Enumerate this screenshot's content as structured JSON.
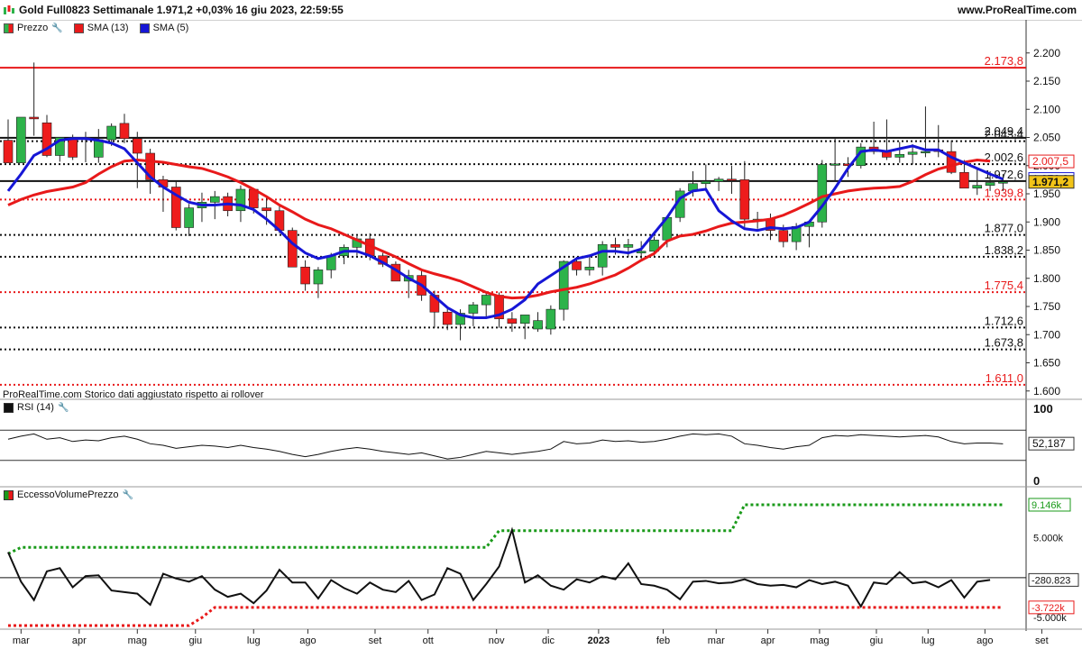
{
  "header": {
    "title": "Gold Full0823 Settimanale 1.971,2 +0,03% 16 giu 2023, 22:59:55",
    "site": "www.ProRealTime.com"
  },
  "legend": {
    "price_label": "Prezzo",
    "sma13_label": "SMA (13)",
    "sma5_label": "SMA (5)"
  },
  "history_note": "ProRealTime.com Storico dati aggiustato rispetto ai rollover",
  "rsi_panel": {
    "label": "RSI (14)",
    "top_tick": "100",
    "bottom_tick": "0",
    "current_value": "52,187"
  },
  "excess_panel": {
    "label": "EccessoVolumePrezzo",
    "top_value": "9.146k",
    "current_value": "-280.823",
    "bottom_value": "-3.722k",
    "tick_5000": "5.000k",
    "tick_0": "0",
    "tick_m5000": "-5.000k"
  },
  "colors": {
    "up": "#2db34a",
    "down": "#ee1c1c",
    "sma13": "#e8191a",
    "sma5": "#1616d6",
    "level_red": "#e8191a",
    "level_black": "#111111",
    "last_price_bg": "#f2c417",
    "accent_green": "#1a9a1a"
  },
  "chart_data": {
    "type": "candlestick",
    "ylim": [
      1590,
      2230
    ],
    "y_ticks": [
      "2.200",
      "2.150",
      "2.100",
      "2.050",
      "2.000",
      "1.950",
      "1.900",
      "1.850",
      "1.800",
      "1.750",
      "1.700",
      "1.650",
      "1.600"
    ],
    "y_tick_values": [
      2200,
      2150,
      2100,
      2050,
      2000,
      1950,
      1900,
      1850,
      1800,
      1750,
      1700,
      1650,
      1600
    ],
    "x_ticks": [
      {
        "label": "mar",
        "week": 1
      },
      {
        "label": "apr",
        "week": 5.5
      },
      {
        "label": "mag",
        "week": 10
      },
      {
        "label": "giu",
        "week": 14.5
      },
      {
        "label": "lug",
        "week": 19
      },
      {
        "label": "ago",
        "week": 23.2
      },
      {
        "label": "set",
        "week": 28.4
      },
      {
        "label": "ott",
        "week": 32.5
      },
      {
        "label": "nov",
        "week": 37.8
      },
      {
        "label": "dic",
        "week": 41.8
      },
      {
        "label": "2023",
        "week": 45.7
      },
      {
        "label": "feb",
        "week": 50.7
      },
      {
        "label": "mar",
        "week": 54.8
      },
      {
        "label": "apr",
        "week": 58.8
      },
      {
        "label": "mag",
        "week": 62.8
      },
      {
        "label": "giu",
        "week": 67.2
      },
      {
        "label": "lug",
        "week": 71.2
      },
      {
        "label": "ago",
        "week": 75.6
      },
      {
        "label": "set",
        "week": 80.0
      }
    ],
    "horizontal_levels": [
      {
        "value": 2173.8,
        "label": "2.173,8",
        "color": "red",
        "style": "solid"
      },
      {
        "value": 2049.4,
        "label": "2.049,4",
        "color": "black",
        "style": "solid"
      },
      {
        "value": 2043.4,
        "label": "2.043,4",
        "color": "black",
        "style": "dotted"
      },
      {
        "value": 2002.6,
        "label": "2.002,6",
        "color": "black",
        "style": "dotted"
      },
      {
        "value": 1972.6,
        "label": "1.972,6",
        "color": "black",
        "style": "solid"
      },
      {
        "value": 1939.8,
        "label": "1.939,8",
        "color": "red",
        "style": "dotted"
      },
      {
        "value": 1877.0,
        "label": "1.877,0",
        "color": "black",
        "style": "dotted"
      },
      {
        "value": 1838.2,
        "label": "1.838,2",
        "color": "black",
        "style": "dotted"
      },
      {
        "value": 1775.4,
        "label": "1.775,4",
        "color": "red",
        "style": "dotted"
      },
      {
        "value": 1712.6,
        "label": "1.712,6",
        "color": "black",
        "style": "dotted"
      },
      {
        "value": 1673.8,
        "label": "1.673,8",
        "color": "black",
        "style": "dotted"
      },
      {
        "value": 1611.0,
        "label": "1.611,0",
        "color": "red",
        "style": "dotted"
      }
    ],
    "last_price": {
      "value": 1971.2,
      "label": "1.971,2"
    },
    "sma13_last": {
      "value": 2007.5,
      "label": "2.007,5"
    },
    "sma5_last": {
      "value": 1976.3,
      "label": "1.976,3"
    },
    "candles": [
      [
        2045,
        2082,
        2008,
        2005
      ],
      [
        2005,
        2070,
        2010,
        2086
      ],
      [
        2086,
        2183,
        2053,
        2083
      ],
      [
        2076,
        2090,
        2015,
        2018
      ],
      [
        2018,
        2040,
        2007,
        2050
      ],
      [
        2048,
        2055,
        2010,
        2015
      ],
      [
        2050,
        2060,
        2006,
        2048
      ],
      [
        2015,
        2065,
        2005,
        2046
      ],
      [
        2046,
        2075,
        2035,
        2070
      ],
      [
        2075,
        2092,
        2040,
        2048
      ],
      [
        2048,
        2060,
        1960,
        2022
      ],
      [
        2022,
        2030,
        1950,
        1975
      ],
      [
        1975,
        1982,
        1918,
        1962
      ],
      [
        1962,
        1972,
        1885,
        1890
      ],
      [
        1890,
        1932,
        1875,
        1925
      ],
      [
        1925,
        1952,
        1900,
        1935
      ],
      [
        1935,
        1955,
        1905,
        1945
      ],
      [
        1945,
        1952,
        1910,
        1920
      ],
      [
        1920,
        1965,
        1900,
        1958
      ],
      [
        1958,
        1960,
        1915,
        1925
      ],
      [
        1925,
        1945,
        1895,
        1920
      ],
      [
        1920,
        1928,
        1880,
        1885
      ],
      [
        1885,
        1890,
        1825,
        1820
      ],
      [
        1820,
        1832,
        1778,
        1790
      ],
      [
        1790,
        1820,
        1765,
        1815
      ],
      [
        1815,
        1845,
        1800,
        1840
      ],
      [
        1840,
        1860,
        1825,
        1855
      ],
      [
        1855,
        1875,
        1840,
        1870
      ],
      [
        1870,
        1880,
        1832,
        1840
      ],
      [
        1840,
        1845,
        1820,
        1825
      ],
      [
        1825,
        1830,
        1800,
        1795
      ],
      [
        1795,
        1815,
        1765,
        1805
      ],
      [
        1805,
        1815,
        1760,
        1770
      ],
      [
        1770,
        1778,
        1712,
        1740
      ],
      [
        1740,
        1750,
        1708,
        1718
      ],
      [
        1718,
        1745,
        1690,
        1738
      ],
      [
        1738,
        1758,
        1715,
        1753
      ],
      [
        1753,
        1775,
        1728,
        1770
      ],
      [
        1770,
        1775,
        1712,
        1728
      ],
      [
        1728,
        1740,
        1705,
        1720
      ],
      [
        1720,
        1730,
        1692,
        1735
      ],
      [
        1710,
        1740,
        1705,
        1725
      ],
      [
        1710,
        1752,
        1700,
        1745
      ],
      [
        1745,
        1832,
        1725,
        1830
      ],
      [
        1830,
        1838,
        1805,
        1815
      ],
      [
        1815,
        1840,
        1805,
        1820
      ],
      [
        1820,
        1866,
        1805,
        1860
      ],
      [
        1860,
        1872,
        1842,
        1855
      ],
      [
        1855,
        1870,
        1838,
        1860
      ],
      [
        1845,
        1866,
        1832,
        1848
      ],
      [
        1848,
        1874,
        1840,
        1868
      ],
      [
        1868,
        1908,
        1855,
        1908
      ],
      [
        1908,
        1960,
        1900,
        1955
      ],
      [
        1955,
        1990,
        1945,
        1968
      ],
      [
        1968,
        2002,
        1958,
        1972
      ],
      [
        1972,
        1980,
        1955,
        1976
      ],
      [
        1976,
        2000,
        1950,
        1975
      ],
      [
        1975,
        2008,
        1890,
        1905
      ],
      [
        1905,
        1918,
        1888,
        1905
      ],
      [
        1905,
        1915,
        1868,
        1885
      ],
      [
        1885,
        1895,
        1855,
        1865
      ],
      [
        1865,
        1898,
        1850,
        1892
      ],
      [
        1892,
        1900,
        1855,
        1900
      ],
      [
        1900,
        2010,
        1890,
        2002
      ],
      [
        2002,
        2048,
        1972,
        2003
      ],
      [
        2003,
        2015,
        1980,
        2000
      ],
      [
        2000,
        2040,
        1995,
        2033
      ],
      [
        2033,
        2078,
        2020,
        2025
      ],
      [
        2025,
        2082,
        2010,
        2015
      ],
      [
        2015,
        2042,
        2005,
        2020
      ],
      [
        2020,
        2038,
        2002,
        2024
      ],
      [
        2024,
        2105,
        2015,
        2025
      ],
      [
        2028,
        2072,
        2015,
        2025
      ],
      [
        2025,
        2045,
        1985,
        1988
      ],
      [
        1988,
        2010,
        1962,
        1960
      ],
      [
        1960,
        1996,
        1948,
        1965
      ],
      [
        1965,
        1990,
        1955,
        1970
      ],
      [
        1970,
        1985,
        1955,
        1971.2
      ]
    ],
    "sma13": [
      1930,
      1940,
      1948,
      1954,
      1958,
      1962,
      1970,
      1985,
      1998,
      2008,
      2010,
      2008,
      2006,
      2002,
      1998,
      1995,
      1988,
      1980,
      1970,
      1958,
      1945,
      1930,
      1918,
      1905,
      1895,
      1888,
      1878,
      1868,
      1858,
      1848,
      1838,
      1826,
      1815,
      1808,
      1802,
      1795,
      1785,
      1775,
      1768,
      1765,
      1766,
      1770,
      1776,
      1780,
      1784,
      1790,
      1798,
      1806,
      1818,
      1832,
      1844,
      1866,
      1875,
      1878,
      1884,
      1892,
      1898,
      1900,
      1902,
      1905,
      1912,
      1922,
      1933,
      1945,
      1950,
      1955,
      1958,
      1960,
      1961,
      1963,
      1972,
      1984,
      1994,
      2000,
      2006,
      2010,
      2008
    ],
    "sma5": [
      1955,
      1985,
      2018,
      2030,
      2045,
      2048,
      2048,
      2045,
      2040,
      2030,
      2005,
      1980,
      1962,
      1948,
      1935,
      1930,
      1930,
      1932,
      1930,
      1922,
      1905,
      1885,
      1862,
      1845,
      1835,
      1840,
      1848,
      1848,
      1840,
      1828,
      1815,
      1800,
      1788,
      1768,
      1748,
      1735,
      1730,
      1730,
      1735,
      1745,
      1762,
      1790,
      1805,
      1820,
      1835,
      1840,
      1848,
      1848,
      1845,
      1852,
      1880,
      1908,
      1942,
      1955,
      1958,
      1920,
      1902,
      1888,
      1885,
      1890,
      1888,
      1890,
      1900,
      1928,
      1960,
      1995,
      2025,
      2028,
      2025,
      2030,
      2035,
      2028,
      2028,
      2015,
      2005,
      1995,
      1985,
      1976
    ]
  }
}
